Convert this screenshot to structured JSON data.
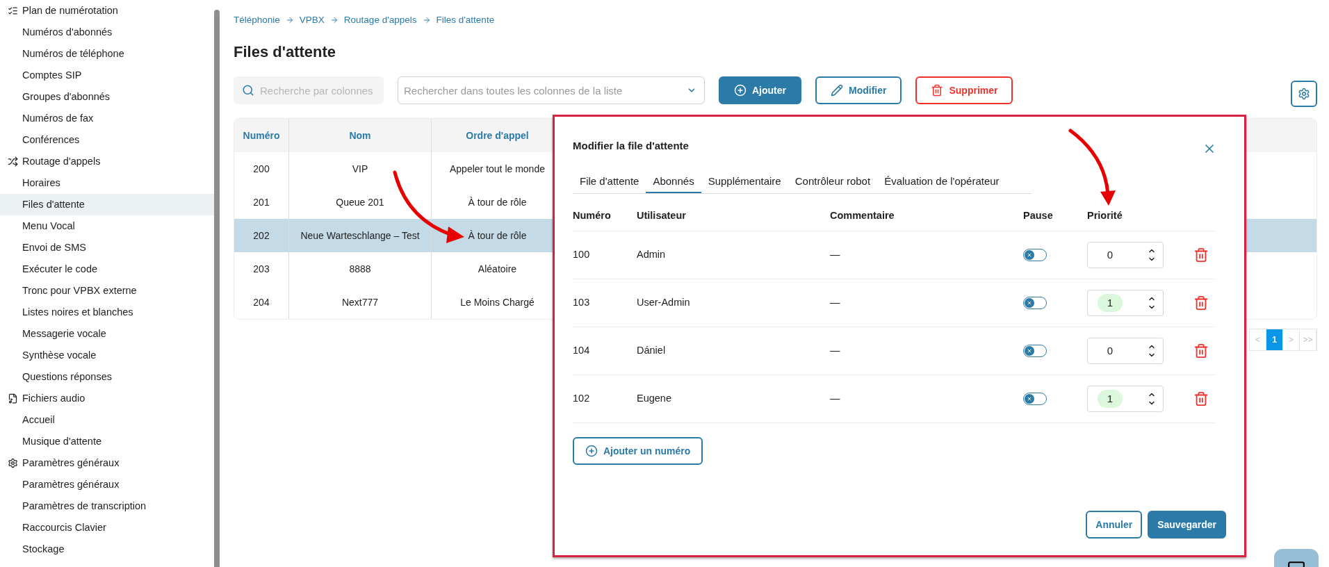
{
  "sidebar": {
    "groups": [
      {
        "label": "Plan de numérotation",
        "items": [
          {
            "label": "Numéros d'abonnés",
            "selected": false
          },
          {
            "label": "Numéros de téléphone",
            "selected": false
          },
          {
            "label": "Comptes SIP",
            "selected": false
          },
          {
            "label": "Groupes d'abonnés",
            "selected": false
          },
          {
            "label": "Numéros de fax",
            "selected": false
          },
          {
            "label": "Conférences",
            "selected": false
          }
        ]
      },
      {
        "label": "Routage d'appels",
        "items": [
          {
            "label": "Horaires",
            "selected": false
          },
          {
            "label": "Files d'attente",
            "selected": true
          },
          {
            "label": "Menu Vocal",
            "selected": false
          },
          {
            "label": "Envoi de SMS",
            "selected": false
          },
          {
            "label": "Exécuter le code",
            "selected": false
          },
          {
            "label": "Tronc pour VPBX externe",
            "selected": false
          },
          {
            "label": "Listes noires et blanches",
            "selected": false
          },
          {
            "label": "Messagerie vocale",
            "selected": false
          },
          {
            "label": "Synthèse vocale",
            "selected": false
          },
          {
            "label": "Questions réponses",
            "selected": false
          }
        ]
      },
      {
        "label": "Fichiers audio",
        "items": [
          {
            "label": "Accueil",
            "selected": false
          },
          {
            "label": "Musique d'attente",
            "selected": false
          }
        ]
      },
      {
        "label": "Paramètres généraux",
        "items": [
          {
            "label": "Paramètres généraux",
            "selected": false
          },
          {
            "label": "Paramètres de transcription",
            "selected": false
          },
          {
            "label": "Raccourcis Clavier",
            "selected": false
          },
          {
            "label": "Stockage",
            "selected": false
          }
        ]
      }
    ]
  },
  "breadcrumb": [
    "Téléphonie",
    "VPBX",
    "Routage d'appels",
    "Files d'attente"
  ],
  "page_title": "Files d'attente",
  "toolbar": {
    "column_search": {
      "placeholder": "Recherche par colonnes"
    },
    "list_search": {
      "placeholder": "Rechercher dans toutes les colonnes de la liste"
    },
    "buttons": [
      {
        "label": "Ajouter",
        "kind": "add"
      },
      {
        "label": "Modifier",
        "kind": "edit"
      },
      {
        "label": "Supprimer",
        "kind": "delete"
      }
    ]
  },
  "table": {
    "columns": [
      "Numéro",
      "Nom",
      "Ordre d'appel"
    ],
    "rows": [
      {
        "cells": [
          "200",
          "VIP",
          "Appeler tout le monde"
        ],
        "selected": false
      },
      {
        "cells": [
          "201",
          "Queue 201",
          "À tour de rôle"
        ],
        "selected": false
      },
      {
        "cells": [
          "202",
          "Neue Warteschlange – Test",
          "À tour de rôle"
        ],
        "selected": true
      },
      {
        "cells": [
          "203",
          "8888",
          "Aléatoire"
        ],
        "selected": false
      },
      {
        "cells": [
          "204",
          "Next777",
          "Le Moins Chargé"
        ],
        "selected": false
      }
    ]
  },
  "pagination": [
    {
      "label": "<",
      "selected": false
    },
    {
      "label": "1",
      "selected": true
    },
    {
      "label": ">",
      "selected": false
    },
    {
      "label": ">>",
      "selected": false
    }
  ],
  "dialog": {
    "title": "Modifier la file d'attente",
    "tabs": [
      {
        "label": "File d'attente",
        "selected": false
      },
      {
        "label": "Abonnés",
        "selected": true
      },
      {
        "label": "Supplémentaire",
        "selected": false
      },
      {
        "label": "Contrôleur robot",
        "selected": false
      },
      {
        "label": "Évaluation de l'opérateur",
        "selected": false
      }
    ],
    "columns": [
      "Numéro",
      "Utilisateur",
      "Commentaire",
      "Pause",
      "Priorité"
    ],
    "rows": [
      {
        "number": "100",
        "user": "Admin",
        "comment": "—",
        "paused": false,
        "priority": "0",
        "highlighted": false
      },
      {
        "number": "103",
        "user": "User-Admin",
        "comment": "—",
        "paused": false,
        "priority": "1",
        "highlighted": true
      },
      {
        "number": "104",
        "user": "Dániel",
        "comment": "—",
        "paused": false,
        "priority": "0",
        "highlighted": false
      },
      {
        "number": "102",
        "user": "Eugene",
        "comment": "—",
        "paused": false,
        "priority": "1",
        "highlighted": true
      }
    ],
    "add_button": "Ajouter un numéro",
    "footer_buttons": [
      {
        "label": "Annuler",
        "kind": "secondary"
      },
      {
        "label": "Sauvegarder",
        "kind": "primary"
      }
    ]
  }
}
